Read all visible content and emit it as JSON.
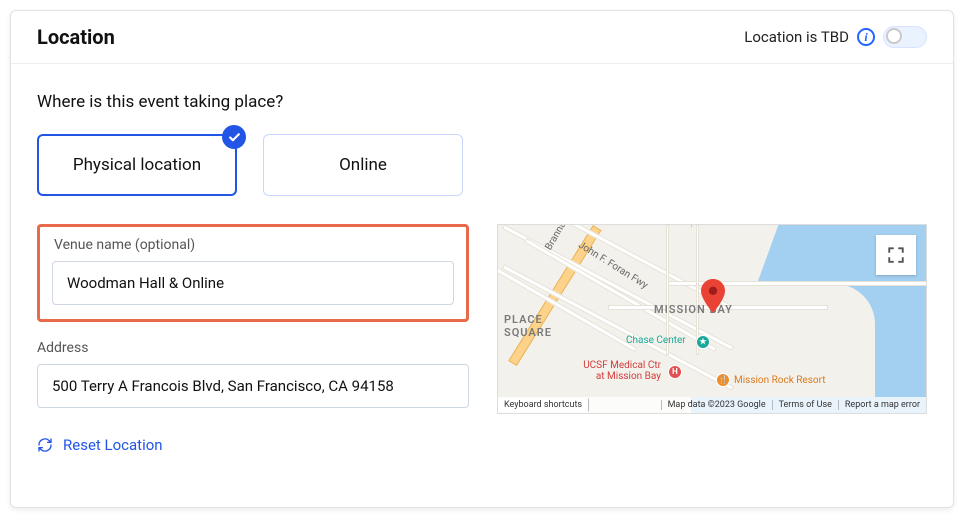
{
  "header": {
    "title": "Location",
    "tbd_label": "Location is TBD"
  },
  "prompt": "Where is this event taking place?",
  "type_options": {
    "physical": "Physical location",
    "online": "Online"
  },
  "venue": {
    "label": "Venue name (optional)",
    "value": "Woodman Hall & Online"
  },
  "address": {
    "label": "Address",
    "value": "500 Terry A Francois Blvd, San Francisco, CA 94158"
  },
  "reset_label": "Reset Location",
  "map": {
    "area_labels": {
      "place_square": "PLACE\nSQUARE",
      "mission_bay": "MISSION BAY"
    },
    "roads": {
      "foran": "John F. Foran Fwy",
      "brannan": "Brannan St"
    },
    "pois": {
      "chase_center": "Chase Center",
      "ucsf": "UCSF Medical Ctr\nat Mission Bay",
      "mission_rock": "Mission Rock Resort"
    },
    "footer": {
      "keyboard": "Keyboard shortcuts",
      "attribution": "Map data ©2023 Google",
      "terms": "Terms of Use",
      "report": "Report a map error"
    }
  }
}
